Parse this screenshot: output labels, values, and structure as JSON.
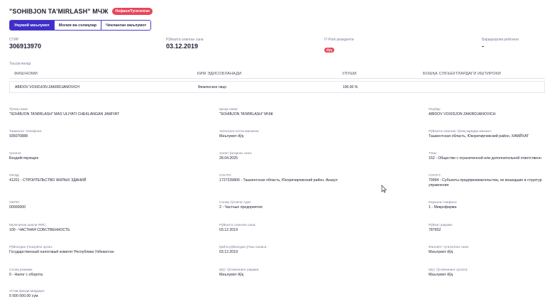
{
  "header": {
    "company_name": "\"SOHIBJON TA'MIRLASH\" МЧЖ",
    "status_badge": "Нофаол/Тугатилган"
  },
  "tabs": [
    {
      "label": "Умумий маълумот",
      "active": true
    },
    {
      "label": "Молия ва солиқлар",
      "active": false
    },
    {
      "label": "Чекланган маълумот",
      "active": false
    }
  ],
  "stats": {
    "stir": {
      "label": "СТИР",
      "value": "306913970"
    },
    "reg_date": {
      "label": "Рўйхатга олинган сана",
      "value": "03.12.2019"
    },
    "itpark": {
      "label": "IT-Park резиденти",
      "value": "Йўқ"
    },
    "reliability": {
      "label": "Барқарорлик рейтинги",
      "value": "-"
    }
  },
  "founders": {
    "section_label": "Таъсисчилар",
    "columns": [
      "ФИШ/НОМИ",
      "КИМ ЭДИСОБЛАНАДИ",
      "УЛУШИ",
      "БОШҚА СУБЪЕКТЛАРДАГИ ИШТИРОКИ"
    ],
    "rows": [
      {
        "name": "ABIDOV VOXIDJON ZAKIRDJANOVICH",
        "type": "Физическое лицо",
        "share": "100.00 %",
        "other": ""
      }
    ]
  },
  "fields": {
    "full_name": {
      "label": "Тўлиқ номи:",
      "value": "\"SOHIBJON TA'MIRLASH\" MAS`ULIYATI CHEKLANGAN JAMIYAT"
    },
    "short_name": {
      "label": "Қисқа номи:",
      "value": "\"SOHIBJON TA'MIRLASH\" МЧЖ"
    },
    "director": {
      "label": "Раҳбар:",
      "value": "ABIDOV VOXIDJON ZAKIRDJANOVICH"
    },
    "phone": {
      "label": "Ташкилот телефони:",
      "value": "935070888"
    },
    "email": {
      "label": "Электрон почта манзили:",
      "value": "Маълумот йўқ"
    },
    "address": {
      "label": "Рўйхатга олинган тўлиқ юридик манзил:",
      "value": "Ташкентская область, Юкоричирчикский район, ХАМЙХАТ"
    },
    "state": {
      "label": "Ҳолати:",
      "value": "Бездействующее"
    },
    "state_date": {
      "label": "Ҳолат ўзгарган сана:",
      "value": "28.04.2025"
    },
    "tkhsh": {
      "label": "ТХШ:",
      "value": "152 - Общество с ограниченной или дополнительной ответственн"
    },
    "okvd": {
      "label": "ОКЭД:",
      "value": "41201 - СТРОИТЕЛЬСТВО ЖИЛЫХ ЗДАНИЙ"
    },
    "soato": {
      "label": "СОАТО:",
      "value": "1727239806 - Ташкентская область, Юкоричирчикский район, Аказул"
    },
    "soogu": {
      "label": "СООГУ:",
      "value": "79994 - Субъекты предпринимательства, не вошедшие в структур управления"
    },
    "okpo": {
      "label": "ОКПО:",
      "value": "00000000"
    },
    "tax_type": {
      "label": "Солиқ тўловчи тури:",
      "value": "2 - Частные предприятия"
    },
    "enterprise_category": {
      "label": "Корхона тоифаси:",
      "value": "1 - Микрофирма"
    },
    "ownership": {
      "label": "Мулкчилик шакли ЯФС:",
      "value": "100 - ЧАСТНАЯ СОБСТВЕННОСТЬ"
    },
    "registration_date": {
      "label": "Рўйхатга олинган сана:",
      "value": "03.12.2019"
    },
    "registration_number": {
      "label": "Рўйхат рақами:",
      "value": "787652"
    },
    "registering_body": {
      "label": "Рўйхатдан ўтказувчи орган:",
      "value": "Государственный налоговый комитет Республики Узбекистан"
    },
    "reregistration_date": {
      "label": "Қайта рўйхатдан ўтиш санаси:",
      "value": "03.12.2019"
    },
    "liquidation_date": {
      "label": "Фаолият тугатилган сана:",
      "value": "Маълумот йўқ"
    },
    "tax_regime": {
      "label": "Солиқ режими:",
      "value": "0 - Налог с оборота"
    },
    "vat_number": {
      "label": "ҚҚС тўловчининг рақами:",
      "value": "Маълумот йўқ"
    },
    "vat_status": {
      "label": "ҚҚС тўловчининг ҳолати:",
      "value": "Маълумот йўқ"
    },
    "charter_fund": {
      "label": "Устав фонди миқдори:",
      "value": "5 000 000.00 сум"
    }
  }
}
